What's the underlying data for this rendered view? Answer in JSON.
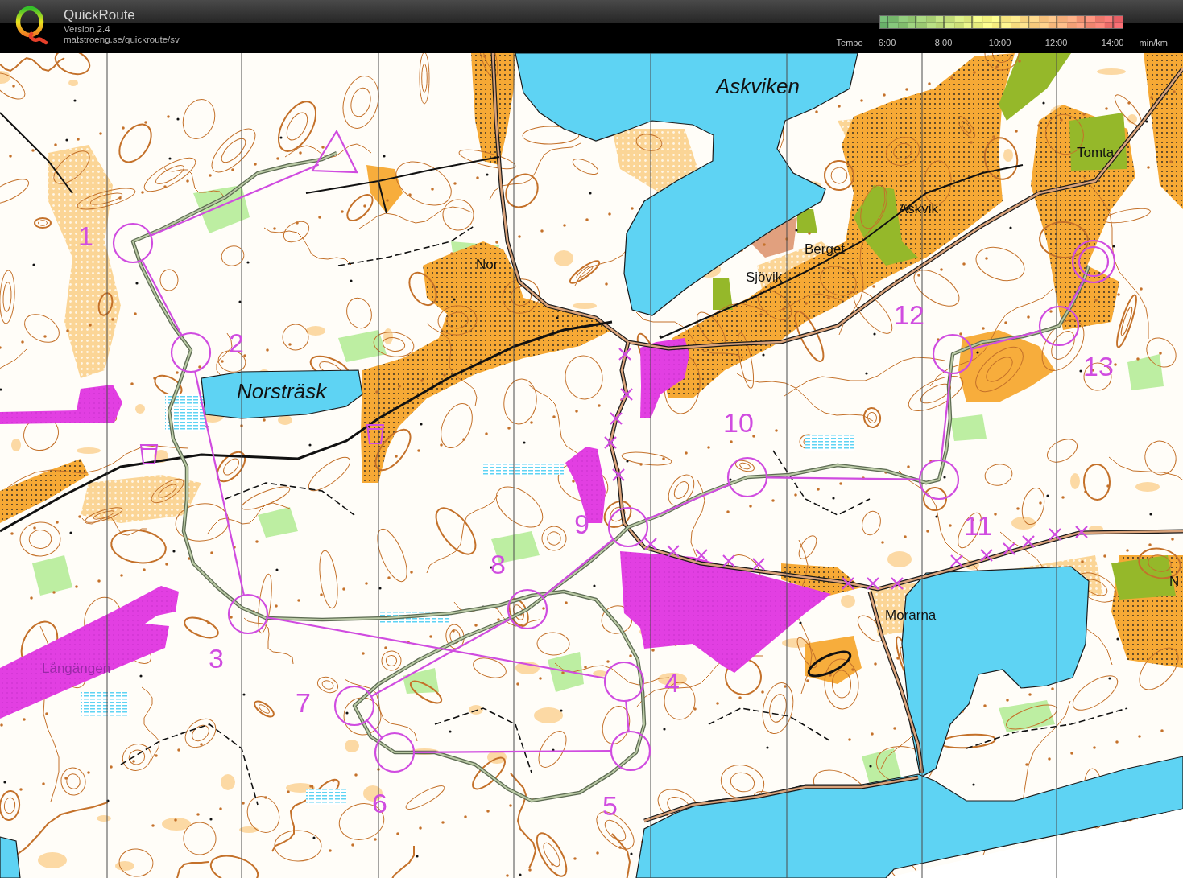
{
  "header": {
    "app_name": "QuickRoute",
    "version": "Version 2.4",
    "url": "matstroeng.se/quickroute/sv"
  },
  "legend": {
    "label": "Tempo",
    "ticks": [
      "6:00",
      "8:00",
      "10:00",
      "12:00",
      "14:00"
    ],
    "unit": "min/km"
  },
  "map": {
    "place_names": [
      {
        "text": "Askviken",
        "kind": "water"
      },
      {
        "text": "Norsträsk",
        "kind": "water"
      },
      {
        "text": "Nor",
        "kind": "place"
      },
      {
        "text": "Sjövik",
        "kind": "place"
      },
      {
        "text": "Berget",
        "kind": "place"
      },
      {
        "text": "Askvik",
        "kind": "place"
      },
      {
        "text": "Tomta",
        "kind": "place"
      },
      {
        "text": "Morarna",
        "kind": "place"
      },
      {
        "text": "Långängen",
        "kind": "restricted"
      },
      {
        "text": "N",
        "kind": "place"
      }
    ],
    "controls": [
      {
        "number": "1"
      },
      {
        "number": "2"
      },
      {
        "number": "3"
      },
      {
        "number": "4"
      },
      {
        "number": "5"
      },
      {
        "number": "6"
      },
      {
        "number": "7"
      },
      {
        "number": "8"
      },
      {
        "number": "9"
      },
      {
        "number": "10"
      },
      {
        "number": "11"
      },
      {
        "number": "12"
      },
      {
        "number": "13"
      }
    ]
  }
}
